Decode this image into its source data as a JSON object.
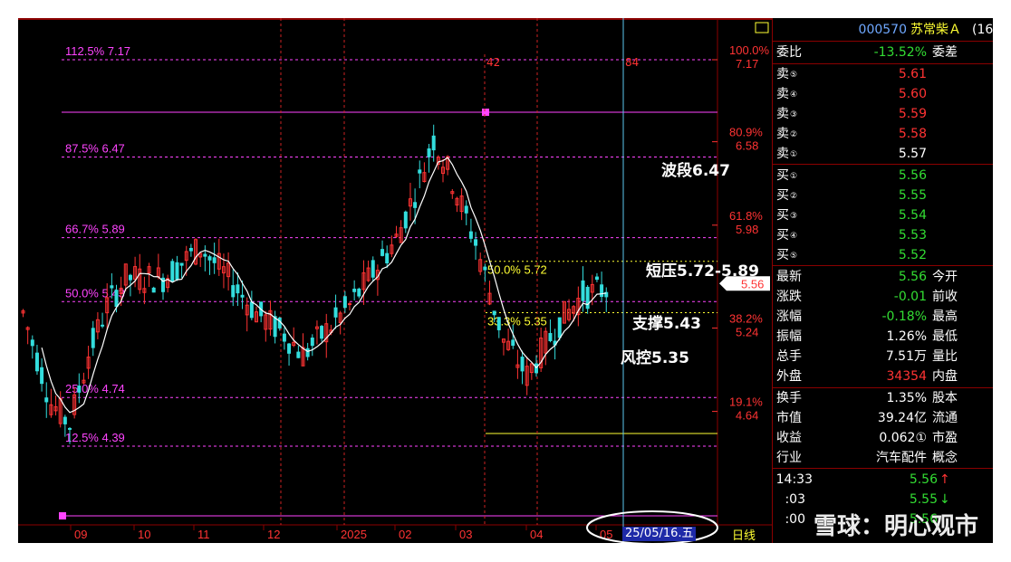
{
  "stock": {
    "code": "000570",
    "name": "苏常柴Ａ",
    "suffix": "(16"
  },
  "fib_levels": [
    {
      "pct": "112.5%",
      "price": "7.17",
      "value": 7.17
    },
    {
      "pct": "87.5%",
      "price": "6.47",
      "value": 6.47
    },
    {
      "pct": "66.7%",
      "price": "5.89",
      "value": 5.89
    },
    {
      "pct": "50.0%",
      "price": "5.43",
      "value": 5.43
    },
    {
      "pct": "25.0%",
      "price": "4.74",
      "value": 4.74
    },
    {
      "pct": "12.5%",
      "price": "4.39",
      "value": 4.39
    }
  ],
  "right_axis": [
    {
      "pct": "100.0%",
      "price": "7.17",
      "value": 7.17
    },
    {
      "pct": "80.9%",
      "price": "6.58",
      "value": 6.58
    },
    {
      "pct": "61.8%",
      "price": "5.98",
      "value": 5.98
    },
    {
      "pct": "38.2%",
      "price": "5.24",
      "value": 5.24
    },
    {
      "pct": "19.1%",
      "price": "4.64",
      "value": 4.64
    }
  ],
  "inner_levels": [
    {
      "pct": "50.0%",
      "price": "5.72",
      "value": 5.72
    },
    {
      "pct": "33.3%",
      "price": "5.35",
      "value": 5.35
    }
  ],
  "markers": {
    "bar_count_a": "42",
    "bar_count_b": "84",
    "current_price": "5.56"
  },
  "annotations": {
    "wave": "波段6.47",
    "short_pressure": "短压5.72-5.89",
    "support": "支撑5.43",
    "risk": "风控5.35"
  },
  "x_axis": [
    "09",
    "10",
    "11",
    "12",
    "2025",
    "02",
    "03",
    "04",
    "05"
  ],
  "cursor_date": "25/05/16.五",
  "bottom_tab": "日线",
  "panel": {
    "weibi": {
      "label": "委比",
      "value": "-13.52%",
      "right": "委差"
    },
    "asks": [
      {
        "label": "卖",
        "n": "⑤",
        "price": "5.61"
      },
      {
        "label": "卖",
        "n": "④",
        "price": "5.60"
      },
      {
        "label": "卖",
        "n": "③",
        "price": "5.59"
      },
      {
        "label": "卖",
        "n": "②",
        "price": "5.58"
      },
      {
        "label": "卖",
        "n": "①",
        "price": "5.57"
      }
    ],
    "bids": [
      {
        "label": "买",
        "n": "①",
        "price": "5.56"
      },
      {
        "label": "买",
        "n": "②",
        "price": "5.55"
      },
      {
        "label": "买",
        "n": "③",
        "price": "5.54"
      },
      {
        "label": "买",
        "n": "④",
        "price": "5.53"
      },
      {
        "label": "买",
        "n": "⑤",
        "price": "5.52"
      }
    ],
    "quote": [
      {
        "label": "最新",
        "value": "5.56",
        "right": "今开",
        "color": "#33dd33"
      },
      {
        "label": "涨跌",
        "value": "-0.01",
        "right": "前收",
        "color": "#33dd33"
      },
      {
        "label": "涨幅",
        "value": "-0.18%",
        "right": "最高",
        "color": "#33dd33"
      },
      {
        "label": "振幅",
        "value": "1.26%",
        "right": "最低",
        "color": "#ffffff"
      },
      {
        "label": "总手",
        "value": "7.51万",
        "right": "量比",
        "color": "#ffffff"
      },
      {
        "label": "外盘",
        "value": "34354",
        "right": "内盘",
        "color": "#ff3333"
      }
    ],
    "info": [
      {
        "label": "换手",
        "value": "1.35%",
        "right": "股本"
      },
      {
        "label": "市值",
        "value": "39.24亿",
        "right": "流通"
      },
      {
        "label": "收益",
        "value": "0.062①",
        "right": "市盈"
      },
      {
        "label": "行业",
        "value": "汽车配件",
        "right": "概念"
      }
    ],
    "ticks": [
      {
        "time": "14:33",
        "price": "5.56",
        "arrow": "↑"
      },
      {
        "time": ":03",
        "price": "5.55",
        "arrow": "↓"
      },
      {
        "time": ":00",
        "price": "5.56",
        "arrow": ""
      }
    ]
  },
  "watermark": "雪球：明心观市",
  "colors": {
    "up": "#ff3333",
    "down": "#33dddd",
    "ma": "#ffffff",
    "fib": "#ff44ff",
    "green": "#33dd33",
    "yellow": "#ffff33",
    "frame": "#8b0000"
  }
}
